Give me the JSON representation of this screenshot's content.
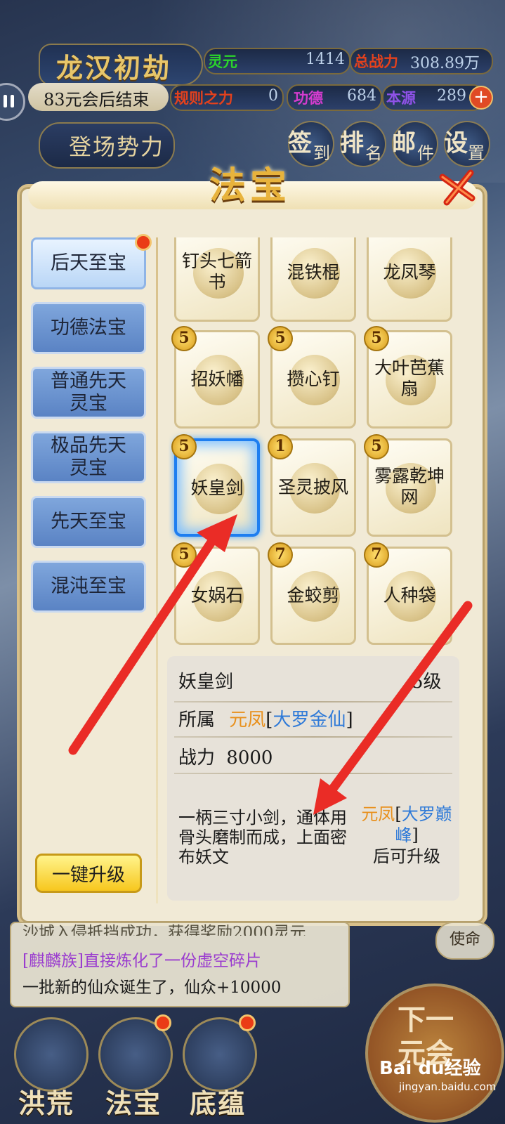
{
  "header": {
    "game_title": "龙汉初劫",
    "countdown": "83元会后结束",
    "faction_label": "登场势力",
    "stats": {
      "lingyuan_label": "灵元",
      "lingyuan_value": "1414",
      "power_label": "总战力",
      "power_value": "308.89万",
      "rules_label": "规则之力",
      "rules_value": "0",
      "merit_label": "功德",
      "merit_value": "684",
      "origin_label": "本源",
      "origin_value": "289"
    },
    "buttons": [
      {
        "main": "签",
        "sub": "到"
      },
      {
        "main": "排",
        "sub": "名"
      },
      {
        "main": "邮",
        "sub": "件"
      },
      {
        "main": "设",
        "sub": "置"
      }
    ]
  },
  "modal": {
    "title": "法宝",
    "tabs": [
      {
        "label": "后天至宝"
      },
      {
        "label": "功德法宝"
      },
      {
        "label": "普通先天灵宝"
      },
      {
        "label": "极品先天灵宝"
      },
      {
        "label": "先天至宝"
      },
      {
        "label": "混沌至宝"
      }
    ],
    "upgrade_all": "一键升级",
    "items": [
      {
        "name": "钉头七箭书",
        "level": ""
      },
      {
        "name": "混铁棍",
        "level": ""
      },
      {
        "name": "龙凤琴",
        "level": ""
      },
      {
        "name": "招妖幡",
        "level": "5"
      },
      {
        "name": "攒心钉",
        "level": "5"
      },
      {
        "name": "大叶芭蕉扇",
        "level": "5"
      },
      {
        "name": "妖皇剑",
        "level": "5"
      },
      {
        "name": "圣灵披风",
        "level": "1"
      },
      {
        "name": "雾露乾坤网",
        "level": "5"
      },
      {
        "name": "女娲石",
        "level": "5"
      },
      {
        "name": "金蛟剪",
        "level": "7"
      },
      {
        "name": "人种袋",
        "level": "7"
      }
    ],
    "detail": {
      "name": "妖皇剑",
      "level": "5级",
      "owner_label": "所属",
      "owner_name": "元凤",
      "owner_rank": "大罗金仙",
      "power_label": "战力",
      "power_value": "8000",
      "description": "一柄三寸小剑，通体用骨头磨制而成，上面密布妖文",
      "req_name": "元凤",
      "req_rank": "大罗巅峰",
      "req_suffix": "后可升级"
    }
  },
  "log": {
    "lines": [
      "沙城入侵抵挡成功，获得奖励2000灵元",
      "[麒麟族]直接炼化了一份虚空碎片",
      "一批新的仙众诞生了，仙众+10000"
    ]
  },
  "bottom_nav": {
    "items": [
      {
        "label": "洪荒"
      },
      {
        "label": "法宝"
      },
      {
        "label": "底蕴"
      }
    ],
    "next_top": "下一",
    "next_bottom": "元会",
    "right_peek": "使命"
  },
  "watermark": {
    "brand": "Bai du经验",
    "url": "jingyan.baidu.com"
  }
}
